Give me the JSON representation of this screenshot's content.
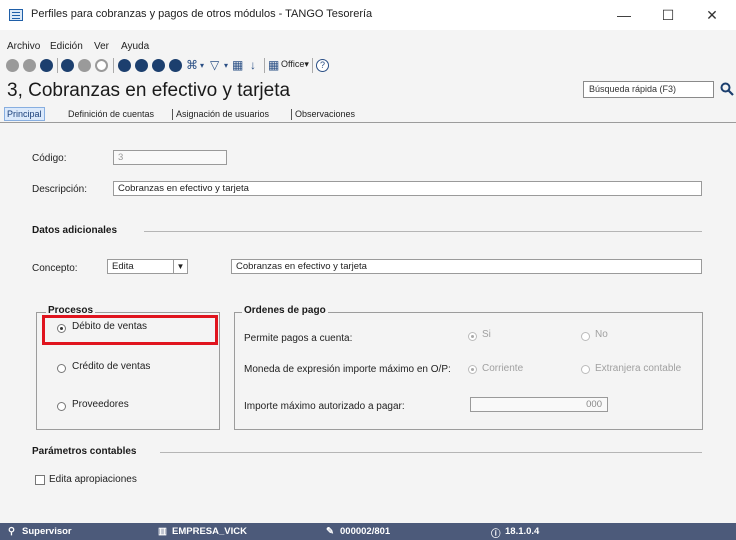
{
  "window": {
    "title": "Perfiles para cobranzas y pagos de otros módulos - TANGO Tesorería",
    "minimize": "—",
    "maximize": "☐",
    "close": "✕"
  },
  "menu": [
    "Archivo",
    "Edición",
    "Ver",
    "Ayuda"
  ],
  "toolbar": {
    "office_label": "Office",
    "office_caret": "▾",
    "glyph_binoculars": "⌘",
    "glyph_filter": "▽",
    "glyph_grid": "▦",
    "glyph_sort": "↓",
    "glyph_help": "?",
    "caret": "▾",
    "icon_colors": {
      "gray": "#9a9a9a",
      "navy": "#1c3f6e"
    }
  },
  "header": {
    "record_title": "3, Cobranzas en efectivo y tarjeta",
    "search_placeholder": "Búsqueda rápida (F3)"
  },
  "tabs": [
    "Principal",
    "Definición de cuentas",
    "Asignación de usuarios",
    "Observaciones"
  ],
  "form": {
    "codigo_label": "Código:",
    "codigo_value": "3",
    "descripcion_label": "Descripción:",
    "descripcion_value": "Cobranzas en efectivo y tarjeta",
    "datos_adicionales": "Datos adicionales",
    "concepto_label": "Concepto:",
    "concepto_value": "Edita",
    "concepto_arrow": "▼",
    "concepto_text": "Cobranzas en efectivo y tarjeta"
  },
  "procesos": {
    "title": "Procesos",
    "options": [
      "Débito de ventas",
      "Crédito de ventas",
      "Proveedores"
    ],
    "selected": "Débito de ventas"
  },
  "ordenes": {
    "title": "Ordenes de pago",
    "permite_label": "Permite pagos a cuenta:",
    "si": "Si",
    "no": "No",
    "moneda_label": "Moneda de expresión importe máximo en O/P:",
    "corriente": "Corriente",
    "extranjera": "Extranjera contable",
    "importe_label": "Importe máximo autorizado a pagar:",
    "importe_value": "000"
  },
  "parametros": {
    "title": "Parámetros contables",
    "edita_apropiaciones": "Edita apropiaciones"
  },
  "status": {
    "user": "Supervisor",
    "company": "EMPRESA_VICK",
    "license": "000002/801",
    "version": "18.1.0.4",
    "bar_color": "#4c5a7a"
  },
  "colors": {
    "highlight": "#e0141e",
    "accent": "#1f5fa8"
  }
}
